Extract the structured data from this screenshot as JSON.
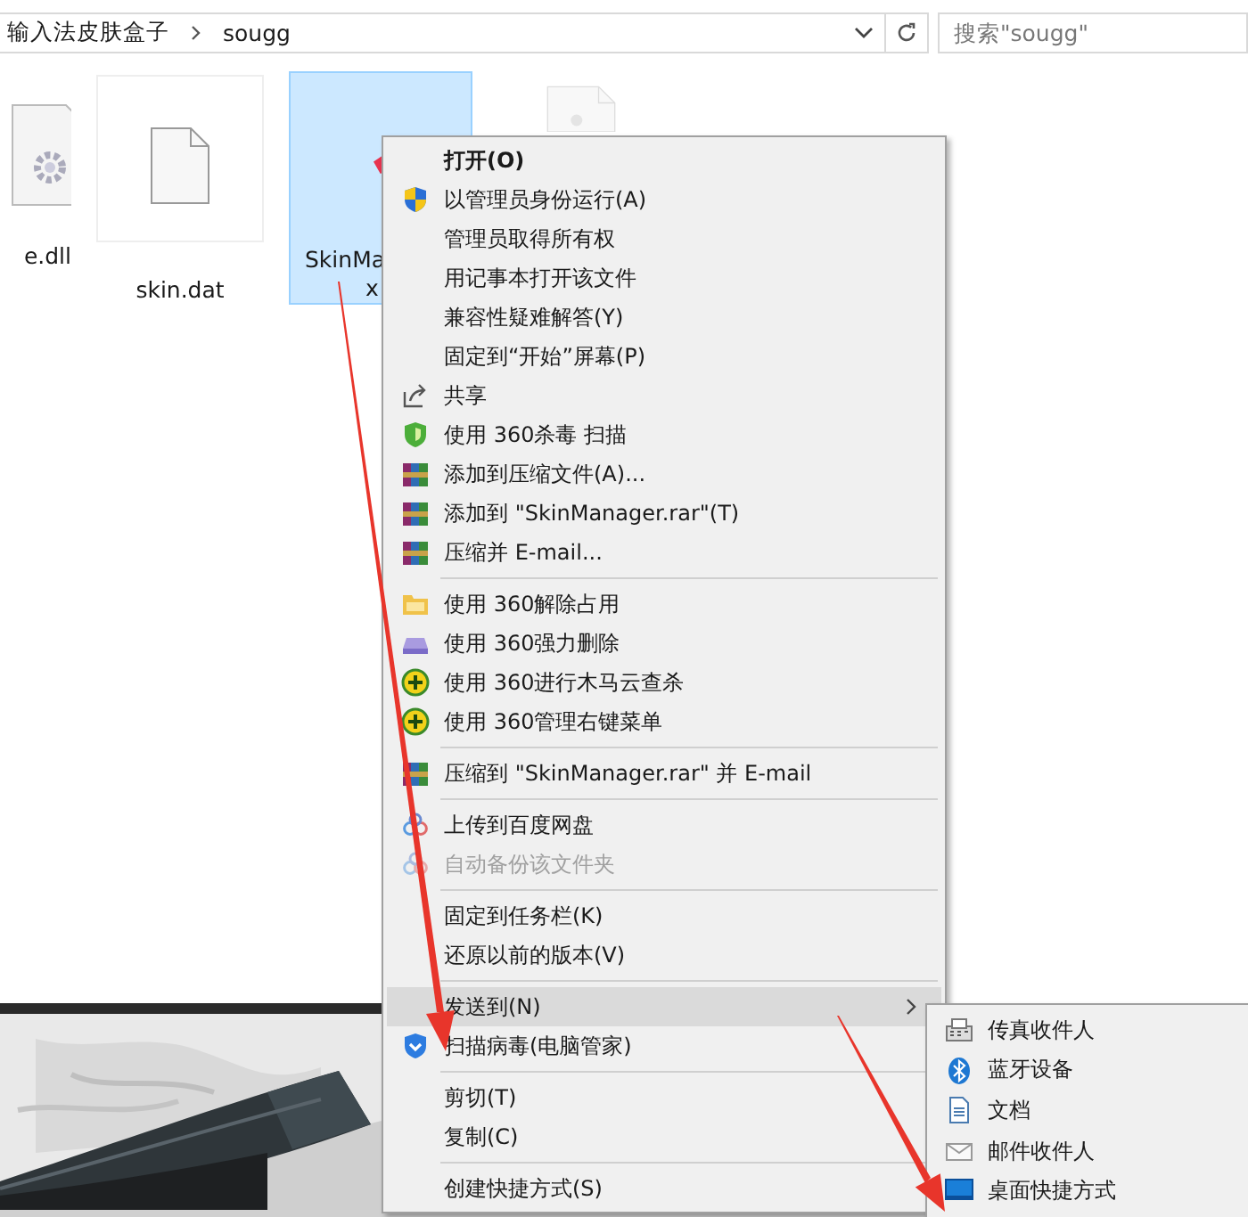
{
  "address_bar": {
    "path": [
      {
        "label": "输入法皮肤盒子"
      },
      {
        "label": "sougg"
      }
    ]
  },
  "search": {
    "placeholder": "搜索\"sougg\""
  },
  "files": [
    {
      "lines": [
        "e.dll"
      ],
      "selected": false
    },
    {
      "lines": [
        "skin.dat"
      ],
      "selected": false
    },
    {
      "lines": [
        "SkinMa",
        "x"
      ],
      "selected": true
    },
    {
      "selected": false
    }
  ],
  "menu": {
    "items": [
      {
        "kind": "item",
        "label": "打开(O)",
        "default": true,
        "disabled": false,
        "selected": false,
        "submenu": false
      },
      {
        "kind": "item",
        "label": "以管理员身份运行(A)",
        "default": false,
        "disabled": false,
        "selected": false,
        "submenu": false
      },
      {
        "kind": "item",
        "label": "管理员取得所有权",
        "default": false,
        "disabled": false,
        "selected": false,
        "submenu": false
      },
      {
        "kind": "item",
        "label": "用记事本打开该文件",
        "default": false,
        "disabled": false,
        "selected": false,
        "submenu": false
      },
      {
        "kind": "item",
        "label": "兼容性疑难解答(Y)",
        "default": false,
        "disabled": false,
        "selected": false,
        "submenu": false
      },
      {
        "kind": "item",
        "label": "固定到“开始”屏幕(P)",
        "default": false,
        "disabled": false,
        "selected": false,
        "submenu": false
      },
      {
        "kind": "item",
        "label": "共享",
        "default": false,
        "disabled": false,
        "selected": false,
        "submenu": false
      },
      {
        "kind": "item",
        "label": "使用 360杀毒 扫描",
        "default": false,
        "disabled": false,
        "selected": false,
        "submenu": false
      },
      {
        "kind": "item",
        "label": "添加到压缩文件(A)...",
        "default": false,
        "disabled": false,
        "selected": false,
        "submenu": false
      },
      {
        "kind": "item",
        "label": "添加到 \"SkinManager.rar\"(T)",
        "default": false,
        "disabled": false,
        "selected": false,
        "submenu": false
      },
      {
        "kind": "item",
        "label": "压缩并 E-mail...",
        "default": false,
        "disabled": false,
        "selected": false,
        "submenu": false
      },
      {
        "kind": "separator"
      },
      {
        "kind": "item",
        "label": "使用 360解除占用",
        "default": false,
        "disabled": false,
        "selected": false,
        "submenu": false
      },
      {
        "kind": "item",
        "label": "使用 360强力删除",
        "default": false,
        "disabled": false,
        "selected": false,
        "submenu": false
      },
      {
        "kind": "item",
        "label": "使用 360进行木马云查杀",
        "default": false,
        "disabled": false,
        "selected": false,
        "submenu": false
      },
      {
        "kind": "item",
        "label": "使用 360管理右键菜单",
        "default": false,
        "disabled": false,
        "selected": false,
        "submenu": false
      },
      {
        "kind": "separator"
      },
      {
        "kind": "item",
        "label": "压缩到 \"SkinManager.rar\" 并 E-mail",
        "default": false,
        "disabled": false,
        "selected": false,
        "submenu": false
      },
      {
        "kind": "separator"
      },
      {
        "kind": "item",
        "label": "上传到百度网盘",
        "default": false,
        "disabled": false,
        "selected": false,
        "submenu": false
      },
      {
        "kind": "item",
        "label": "自动备份该文件夹",
        "default": false,
        "disabled": true,
        "selected": false,
        "submenu": false
      },
      {
        "kind": "separator"
      },
      {
        "kind": "item",
        "label": "固定到任务栏(K)",
        "default": false,
        "disabled": false,
        "selected": false,
        "submenu": false
      },
      {
        "kind": "item",
        "label": "还原以前的版本(V)",
        "default": false,
        "disabled": false,
        "selected": false,
        "submenu": false
      },
      {
        "kind": "separator"
      },
      {
        "kind": "item",
        "label": "发送到(N)",
        "default": false,
        "disabled": false,
        "selected": true,
        "submenu": true
      },
      {
        "kind": "item",
        "label": "扫描病毒(电脑管家)",
        "default": false,
        "disabled": false,
        "selected": false,
        "submenu": false
      },
      {
        "kind": "separator"
      },
      {
        "kind": "item",
        "label": "剪切(T)",
        "default": false,
        "disabled": false,
        "selected": false,
        "submenu": false
      },
      {
        "kind": "item",
        "label": "复制(C)",
        "default": false,
        "disabled": false,
        "selected": false,
        "submenu": false
      },
      {
        "kind": "separator"
      },
      {
        "kind": "item",
        "label": "创建快捷方式(S)",
        "default": false,
        "disabled": false,
        "selected": false,
        "submenu": false
      }
    ]
  },
  "send_to_menu": {
    "items": [
      {
        "label": "传真收件人"
      },
      {
        "label": "蓝牙设备"
      },
      {
        "label": "文档"
      },
      {
        "label": "邮件收件人"
      },
      {
        "label": "桌面快捷方式"
      }
    ]
  }
}
